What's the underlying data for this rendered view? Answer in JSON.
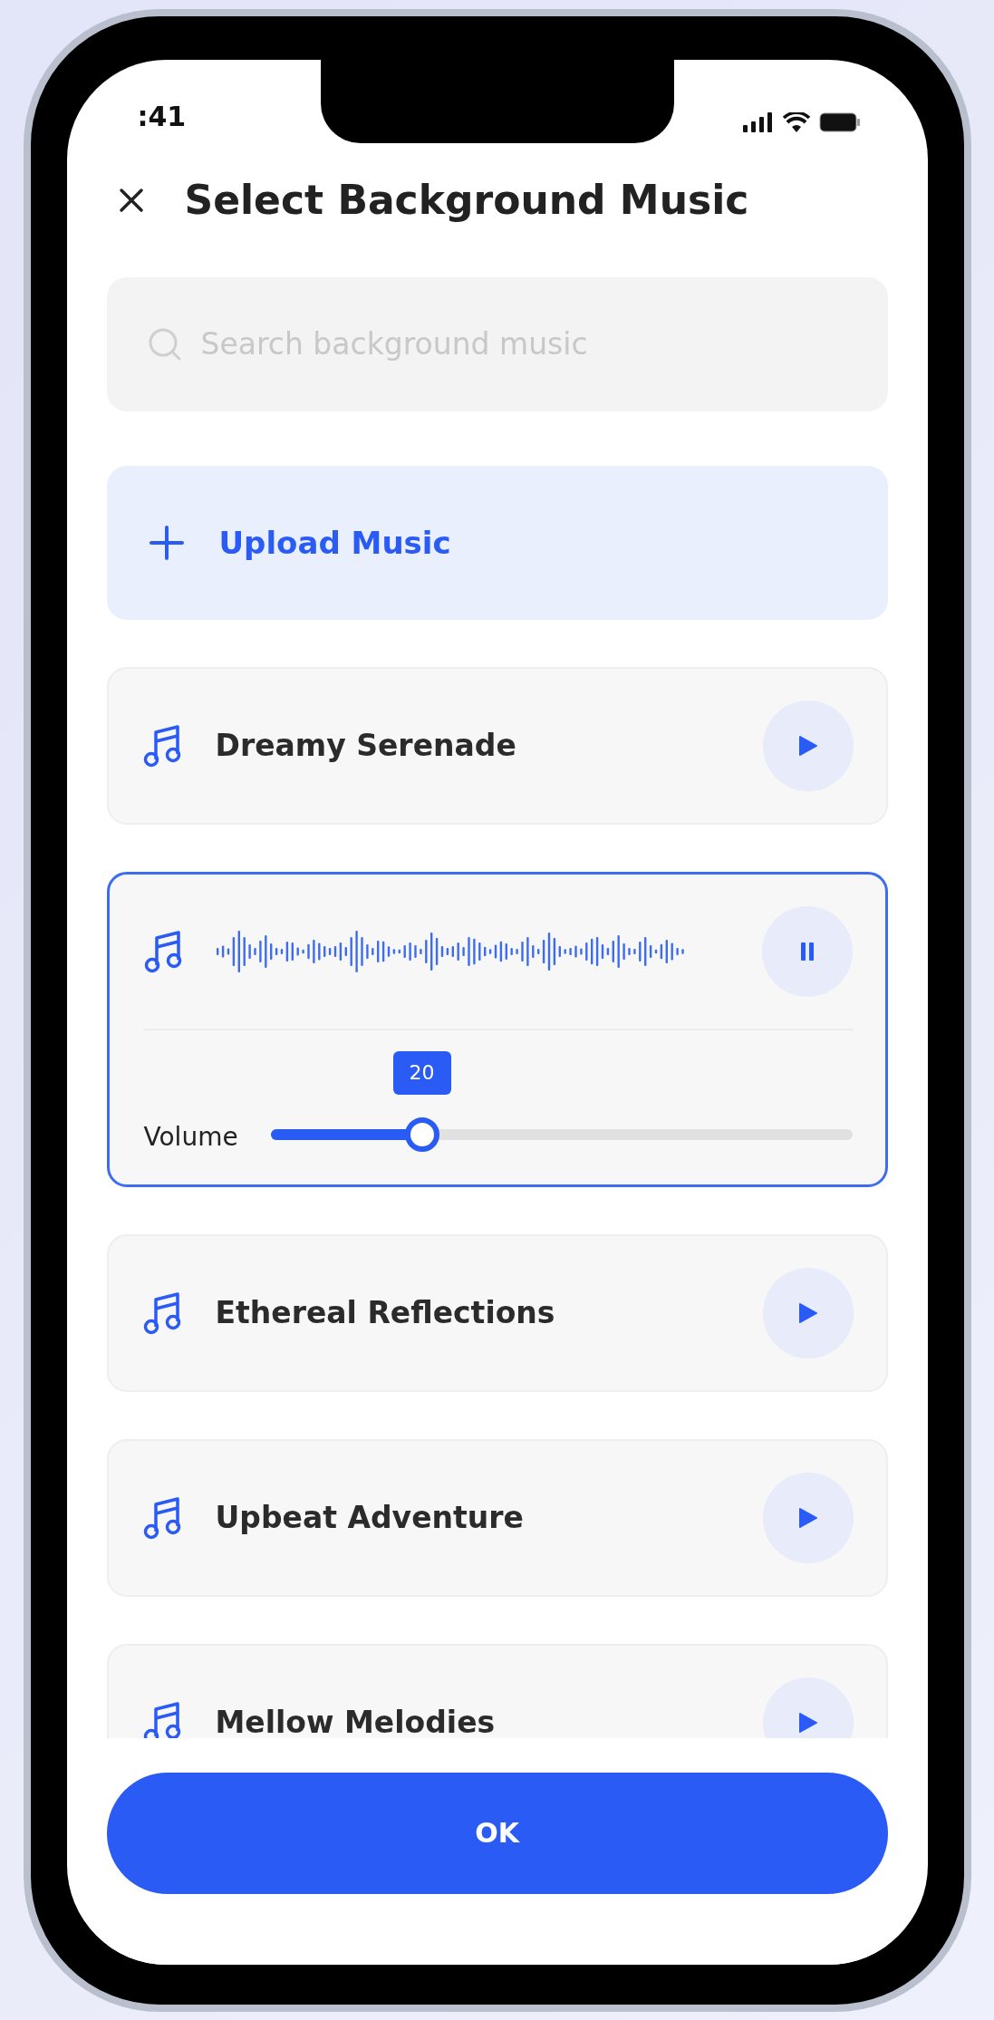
{
  "status_bar": {
    "time": ":41"
  },
  "header": {
    "title": "Select Background Music"
  },
  "search": {
    "placeholder": "Search background music"
  },
  "upload": {
    "label": "Upload Music"
  },
  "tracks": [
    {
      "kind": "track",
      "title": "Dreamy Serenade",
      "playing": false
    },
    {
      "kind": "player",
      "playing": true,
      "volume": {
        "label": "Volume",
        "value": "20",
        "level": 0.26
      }
    },
    {
      "kind": "track",
      "title": "Ethereal Reflections",
      "playing": false
    },
    {
      "kind": "track",
      "title": "Upbeat Adventure",
      "playing": false
    },
    {
      "kind": "track",
      "title": "Mellow Melodies",
      "playing": false
    }
  ],
  "footer": {
    "button": "OK"
  }
}
